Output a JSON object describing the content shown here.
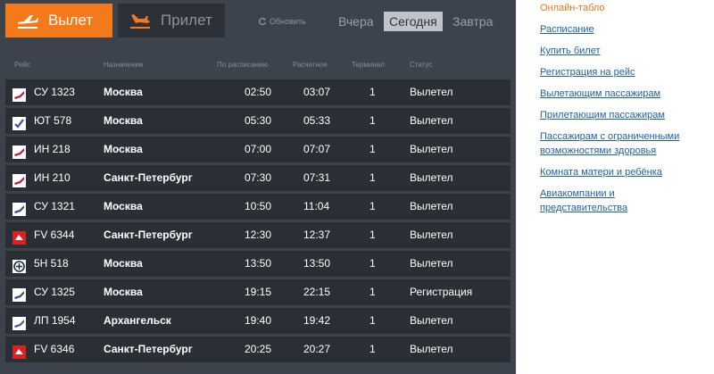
{
  "tabs": {
    "departures": "Вылет",
    "arrivals": "Прилет"
  },
  "refresh_label": "Обновить",
  "days": {
    "yesterday": "Вчера",
    "today": "Сегодня",
    "tomorrow": "Завтра"
  },
  "columns": [
    "Рейс",
    "Назначение",
    "По расписанию",
    "Расчетное",
    "Терминал",
    "Статус"
  ],
  "flights": [
    {
      "logo": "airline-logo-red-wing",
      "logo_color": "#c8102e",
      "flight": "СУ 1323",
      "destination": "Москва",
      "scheduled": "02:50",
      "estimated": "03:07",
      "terminal": "1",
      "status": "Вылетел"
    },
    {
      "logo": "airline-logo-check",
      "logo_color": "#3a4fa0",
      "flight": "ЮТ 578",
      "destination": "Москва",
      "scheduled": "05:30",
      "estimated": "05:33",
      "terminal": "1",
      "status": "Вылетел"
    },
    {
      "logo": "airline-logo-red-wing",
      "logo_color": "#c8102e",
      "flight": "ИН 218",
      "destination": "Москва",
      "scheduled": "07:00",
      "estimated": "07:07",
      "terminal": "1",
      "status": "Вылетел"
    },
    {
      "logo": "airline-logo-red-wing",
      "logo_color": "#c8102e",
      "flight": "ИН 210",
      "destination": "Санкт-Петербург",
      "scheduled": "07:30",
      "estimated": "07:31",
      "terminal": "1",
      "status": "Вылетел"
    },
    {
      "logo": "airline-logo-aeroflot",
      "logo_color": "#2f4a8a",
      "flight": "СУ 1321",
      "destination": "Москва",
      "scheduled": "10:50",
      "estimated": "11:04",
      "terminal": "1",
      "status": "Вылетел"
    },
    {
      "logo": "airline-logo-red-square",
      "logo_color": "#e0201b",
      "flight": "FV 6344",
      "destination": "Санкт-Петербург",
      "scheduled": "12:30",
      "estimated": "12:37",
      "terminal": "1",
      "status": "Вылетел"
    },
    {
      "logo": "airline-logo-circle",
      "logo_color": "#1c2a4a",
      "flight": "5Н 518",
      "destination": "Москва",
      "scheduled": "13:50",
      "estimated": "13:50",
      "terminal": "1",
      "status": "Вылетел"
    },
    {
      "logo": "airline-logo-aeroflot",
      "logo_color": "#2f4a8a",
      "flight": "СУ 1325",
      "destination": "Москва",
      "scheduled": "19:15",
      "estimated": "22:15",
      "terminal": "1",
      "status": "Регистрация"
    },
    {
      "logo": "airline-logo-blue-wing",
      "logo_color": "#3a5a9a",
      "flight": "ЛП 1954",
      "destination": "Архангельск",
      "scheduled": "19:40",
      "estimated": "19:42",
      "terminal": "1",
      "status": "Вылетел"
    },
    {
      "logo": "airline-logo-red-square",
      "logo_color": "#e0201b",
      "flight": "FV 6346",
      "destination": "Санкт-Петербург",
      "scheduled": "20:25",
      "estimated": "20:27",
      "terminal": "1",
      "status": "Вылетел"
    }
  ],
  "sidebar_links": [
    {
      "lines": [
        "Онлайн-табло"
      ],
      "active": true
    },
    {
      "lines": [
        "Расписание"
      ]
    },
    {
      "lines": [
        "Купить билет"
      ]
    },
    {
      "lines": [
        "Регистрация на рейс"
      ]
    },
    {
      "lines": [
        "Вылетающим пассажирам"
      ]
    },
    {
      "lines": [
        "Прилетающим пассажирам"
      ]
    },
    {
      "lines": [
        "Пассажирам с ограниченными",
        "возможностями здоровья"
      ]
    },
    {
      "lines": [
        "Комната матери и ребёнка"
      ]
    },
    {
      "lines": [
        "Авиакомпании и",
        "представительства"
      ]
    }
  ],
  "colors": {
    "accent": "#f27a1a",
    "board_bg": "#3d434d",
    "row_bg": "#2a2f36",
    "link": "#1f5fa6"
  }
}
